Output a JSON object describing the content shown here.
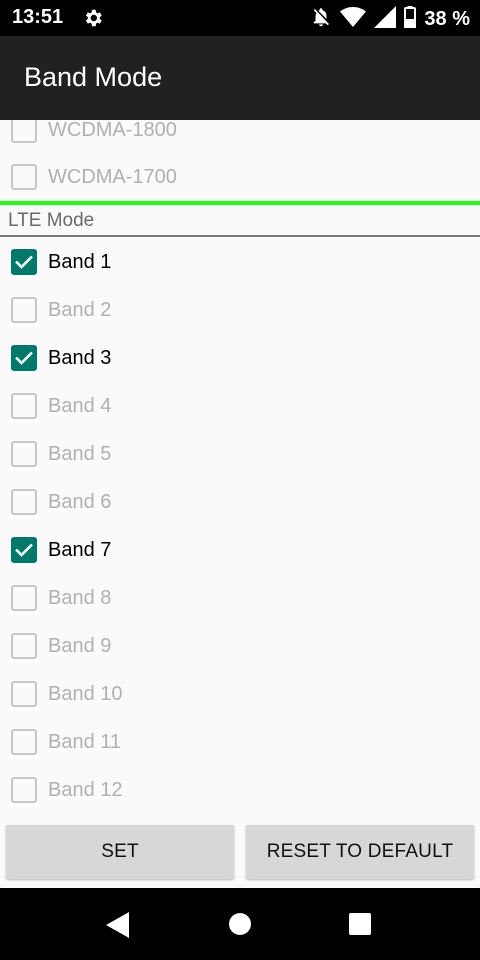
{
  "status_bar": {
    "time": "13:51",
    "battery_text": "38 %",
    "icons": [
      "gear-icon",
      "notifications-off-icon",
      "wifi-icon",
      "signal-icon",
      "battery-icon"
    ]
  },
  "app_bar": {
    "title": "Band Mode"
  },
  "wcdma_items": [
    {
      "label": "WCDMA-1800",
      "checked": false
    },
    {
      "label": "WCDMA-1700",
      "checked": false
    }
  ],
  "lte_section": {
    "header": "LTE Mode",
    "items": [
      {
        "label": "Band 1",
        "checked": true
      },
      {
        "label": "Band 2",
        "checked": false
      },
      {
        "label": "Band 3",
        "checked": true
      },
      {
        "label": "Band 4",
        "checked": false
      },
      {
        "label": "Band 5",
        "checked": false
      },
      {
        "label": "Band 6",
        "checked": false
      },
      {
        "label": "Band 7",
        "checked": true
      },
      {
        "label": "Band 8",
        "checked": false
      },
      {
        "label": "Band 9",
        "checked": false
      },
      {
        "label": "Band 10",
        "checked": false
      },
      {
        "label": "Band 11",
        "checked": false
      },
      {
        "label": "Band 12",
        "checked": false
      }
    ]
  },
  "buttons": {
    "set_label": "SET",
    "reset_label": "RESET TO DEFAULT"
  },
  "nav_bar": {
    "icons": [
      "back-icon",
      "home-icon",
      "recents-icon"
    ]
  },
  "colors": {
    "accent": "#00796b",
    "divider_highlight": "#1eff10",
    "app_bar": "#212121"
  }
}
